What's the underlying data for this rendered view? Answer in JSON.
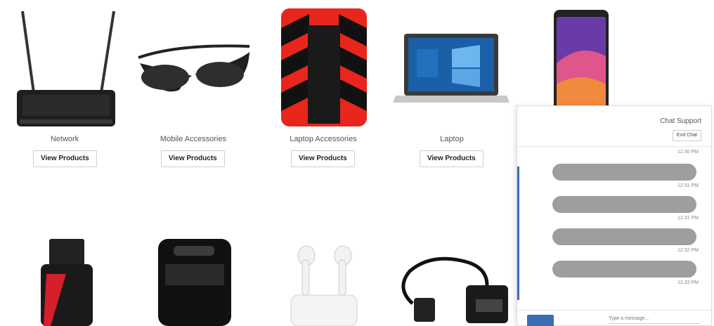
{
  "products": [
    {
      "name": "Network",
      "button": "View Products",
      "image": "router-image"
    },
    {
      "name": "Mobile Accessories",
      "button": "View Products",
      "image": "camera-glasses-image"
    },
    {
      "name": "Laptop Accessories",
      "button": "View Products",
      "image": "external-hdd-image"
    },
    {
      "name": "Laptop",
      "button": "View Products",
      "image": "laptop-image"
    },
    {
      "name": "",
      "button": "",
      "image": "smartphone-image"
    },
    {
      "name": "",
      "button": "",
      "image": "usb-flash-drive-image"
    },
    {
      "name": "",
      "button": "",
      "image": "usb-flash-drive-black-image"
    },
    {
      "name": "",
      "button": "",
      "image": "wireless-earbuds-image"
    },
    {
      "name": "",
      "button": "",
      "image": "otg-cable-image"
    }
  ],
  "chat": {
    "title": "Chat Support",
    "end_button": "End Chat",
    "timestamps": [
      "12:30 PM",
      "12:31 PM",
      "12:31 PM",
      "12:32 PM",
      "12:33 PM"
    ],
    "input_placeholder": "Type a message..."
  }
}
